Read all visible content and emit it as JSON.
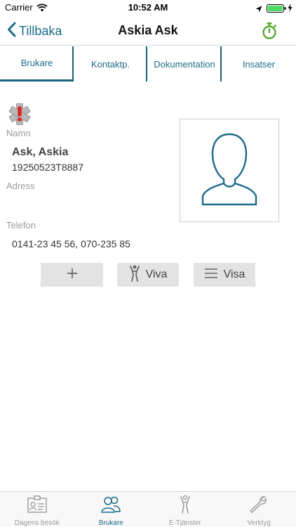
{
  "status_bar": {
    "carrier": "Carrier",
    "time": "10:52 AM",
    "battery_color": "#4cd964"
  },
  "nav": {
    "back_label": "Tillbaka",
    "title": "Askia Ask",
    "accent_color": "#1b6b8a",
    "timer_icon_color": "#5aa832"
  },
  "tabs": [
    {
      "label": "Brukare",
      "active": true
    },
    {
      "label": "Kontaktp.",
      "active": false
    },
    {
      "label": "Dokumentation",
      "active": false
    },
    {
      "label": "Insatser",
      "active": false
    }
  ],
  "patient": {
    "alert_icon": "medical-alert-icon",
    "name_label": "Namn",
    "name": "Ask, Askia",
    "personnummer": "19250523T8887",
    "address_label": "Adress",
    "address": "",
    "phone_label": "Telefon",
    "phone": "0141-23 45 56, 070-235 85",
    "photo_icon": "user-silhouette-icon"
  },
  "actions": [
    {
      "label": "",
      "icon": "plus-icon"
    },
    {
      "label": "Viva",
      "icon": "person-icon"
    },
    {
      "label": "Visa",
      "icon": "menu-icon"
    }
  ],
  "tabbar": [
    {
      "label": "Dagens besök",
      "icon": "id-card-icon",
      "active": false
    },
    {
      "label": "Brukare",
      "icon": "users-icon",
      "active": true
    },
    {
      "label": "E-Tjänster",
      "icon": "e-services-icon",
      "active": false
    },
    {
      "label": "Verktyg",
      "icon": "wrench-icon",
      "active": false
    }
  ]
}
